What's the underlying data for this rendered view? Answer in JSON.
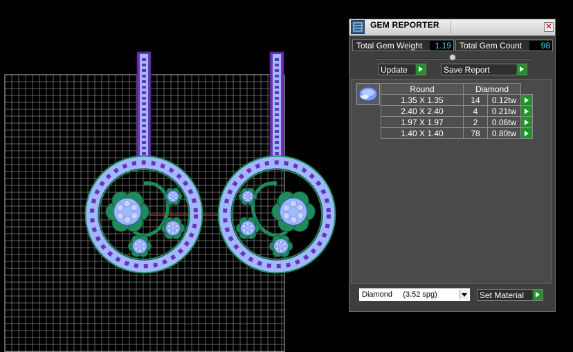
{
  "panel": {
    "title": "GEM REPORTER",
    "close_glyph": "✕",
    "total_weight_label": "Total Gem Weight",
    "total_weight_value": "1.19",
    "total_count_label": "Total Gem Count",
    "total_count_value": "98",
    "update_label": "Update",
    "save_report_label": "Save Report",
    "table": {
      "headers": [
        "Round",
        "Diamond"
      ],
      "rows": [
        {
          "size": "1.35 X 1.35",
          "count": "14",
          "weight": "0.12tw"
        },
        {
          "size": "2.40 X 2.40",
          "count": "4",
          "weight": "0.21tw"
        },
        {
          "size": "1.97 X 1.97",
          "count": "2",
          "weight": "0.06tw"
        },
        {
          "size": "1.40 X 1.40",
          "count": "78",
          "weight": "0.80tw"
        }
      ]
    },
    "material_select_value": "Diamond     (3.52 spg)",
    "set_material_label": "Set Material"
  },
  "colors": {
    "background": "#000000",
    "grid": "#bfbfbf",
    "metal": "#1f8a5a",
    "gem_outer": "#9fb8ff",
    "gem_inner": "#6a34b5",
    "accent_play": "#23912a",
    "value_text": "#3fd3ff"
  },
  "icons": {
    "title_icon": "gem-reporter-icon",
    "play": "play-arrow-icon",
    "dropdown": "chevron-down-icon",
    "close": "close-icon",
    "gem_thumbnail": "round-gem-icon"
  }
}
